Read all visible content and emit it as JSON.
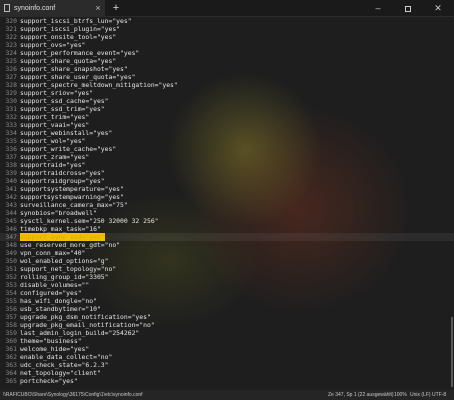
{
  "tab": {
    "title": "synoinfo.conf",
    "close_glyph": "×"
  },
  "window_controls": {
    "min_glyph": "–",
    "close_glyph": "✕"
  },
  "new_tab_glyph": "+",
  "editor": {
    "current_line_number": "347",
    "lines": [
      {
        "num": "320",
        "text": "support_iscsi_btrfs_lun=\"yes\""
      },
      {
        "num": "321",
        "text": "support_iscsi_plugin=\"yes\""
      },
      {
        "num": "322",
        "text": "support_onsite_tool=\"yes\""
      },
      {
        "num": "323",
        "text": "support_ovs=\"yes\""
      },
      {
        "num": "324",
        "text": "support_performance_event=\"yes\""
      },
      {
        "num": "325",
        "text": "support_share_quota=\"yes\""
      },
      {
        "num": "326",
        "text": "support_share_snapshot=\"yes\""
      },
      {
        "num": "327",
        "text": "support_share_user_quota=\"yes\""
      },
      {
        "num": "328",
        "text": "support_spectre_meltdown_mitigation=\"yes\""
      },
      {
        "num": "329",
        "text": "support_sriov=\"yes\""
      },
      {
        "num": "330",
        "text": "support_ssd_cache=\"yes\""
      },
      {
        "num": "331",
        "text": "support_ssd_trim=\"yes\""
      },
      {
        "num": "332",
        "text": "support_trim=\"yes\""
      },
      {
        "num": "333",
        "text": "support_vaai=\"yes\""
      },
      {
        "num": "334",
        "text": "support_webinstall=\"yes\""
      },
      {
        "num": "335",
        "text": "support_wol=\"yes\""
      },
      {
        "num": "336",
        "text": "support_write_cache=\"yes\""
      },
      {
        "num": "337",
        "text": "support_zram=\"yes\""
      },
      {
        "num": "338",
        "text": "supportraid=\"yes\""
      },
      {
        "num": "339",
        "text": "supportraidcross=\"yes\""
      },
      {
        "num": "340",
        "text": "supportraidgroup=\"yes\""
      },
      {
        "num": "341",
        "text": "supportsystemperature=\"yes\""
      },
      {
        "num": "342",
        "text": "supportsystempwarning=\"yes\""
      },
      {
        "num": "343",
        "text": "surveillance_camera_max=\"75\""
      },
      {
        "num": "344",
        "text": "synobios=\"broadwell\""
      },
      {
        "num": "345",
        "text": "sysctl_kernel.sem=\"250 32000 32 256\""
      },
      {
        "num": "346",
        "text": "timebkp_max_task=\"16\""
      },
      {
        "num": "347",
        "text": "support_sync_ssd=\"yes\""
      },
      {
        "num": "348",
        "text": "use_reserved_more_gdt=\"no\""
      },
      {
        "num": "349",
        "text": "vpn_conn_max=\"40\""
      },
      {
        "num": "350",
        "text": "wol_enabled_options=\"g\""
      },
      {
        "num": "351",
        "text": "support_net_topology=\"no\""
      },
      {
        "num": "352",
        "text": "rolling_group_id=\"3305\""
      },
      {
        "num": "353",
        "text": "disable_volumes=\"\""
      },
      {
        "num": "354",
        "text": "configured=\"yes\""
      },
      {
        "num": "355",
        "text": "has_wifi_dongle=\"no\""
      },
      {
        "num": "356",
        "text": "usb_standbytimer=\"10\""
      },
      {
        "num": "357",
        "text": "upgrade_pkg_dsm_notification=\"yes\""
      },
      {
        "num": "358",
        "text": "upgrade_pkg_email_notification=\"no\""
      },
      {
        "num": "359",
        "text": "last_admin_login_build=\"254262\""
      },
      {
        "num": "360",
        "text": "theme=\"business\""
      },
      {
        "num": "361",
        "text": "welcome_hide=\"yes\""
      },
      {
        "num": "362",
        "text": "enable_data_collect=\"no\""
      },
      {
        "num": "363",
        "text": "udc_check_state=\"6.2.3\""
      },
      {
        "num": "364",
        "text": "net_topology=\"client\""
      },
      {
        "num": "365",
        "text": "portcheck=\"yes\""
      }
    ]
  },
  "status": {
    "path": "\\\\RAFICUBO\\Share\\Synology\\36175\\Config\\1\\etc\\synoinfo.conf",
    "position": "Ze 347, Sp 1 (22 ausgewählt)",
    "zoom": "100%",
    "eol": "Unix (LF)",
    "encoding": "UTF-8"
  },
  "colors": {
    "background": "#1e1e1e",
    "text": "#e8e8e8",
    "line_number": "#8a8a8a",
    "selection": "#f0c000"
  }
}
